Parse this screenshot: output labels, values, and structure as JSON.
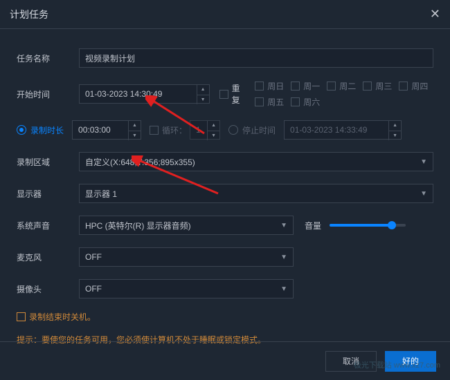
{
  "title": "计划任务",
  "labels": {
    "task_name": "任务名称",
    "start_time": "开始时间",
    "repeat": "重复",
    "duration": "录制时长",
    "loop": "循环：",
    "stop_time": "停止时间",
    "record_area": "录制区域",
    "display": "显示器",
    "system_audio": "系统声音",
    "volume": "音量",
    "microphone": "麦克风",
    "camera": "摄像头"
  },
  "values": {
    "task_name": "视频录制计划",
    "start_time": "01-03-2023 14:30:49",
    "duration": "00:03:00",
    "loop_count": "1",
    "stop_time": "01-03-2023 14:33:49",
    "record_area": "自定义(X:648,Y:356;895x355)",
    "display": "显示器 1",
    "system_audio": "HPC (英特尔(R) 显示器音频)",
    "microphone": "OFF",
    "camera": "OFF",
    "volume_percent": 82
  },
  "days": [
    "周日",
    "周一",
    "周二",
    "周三",
    "周四",
    "周五",
    "周六"
  ],
  "shutdown_label": "录制结束时关机。",
  "hint_prefix": "提示：",
  "hint_text": "要使您的任务可用，您必须使计算机不处于睡眠或锁定模式。",
  "buttons": {
    "cancel": "取消",
    "ok": "好的"
  },
  "watermark": "极光下载站 www.xz7.com"
}
